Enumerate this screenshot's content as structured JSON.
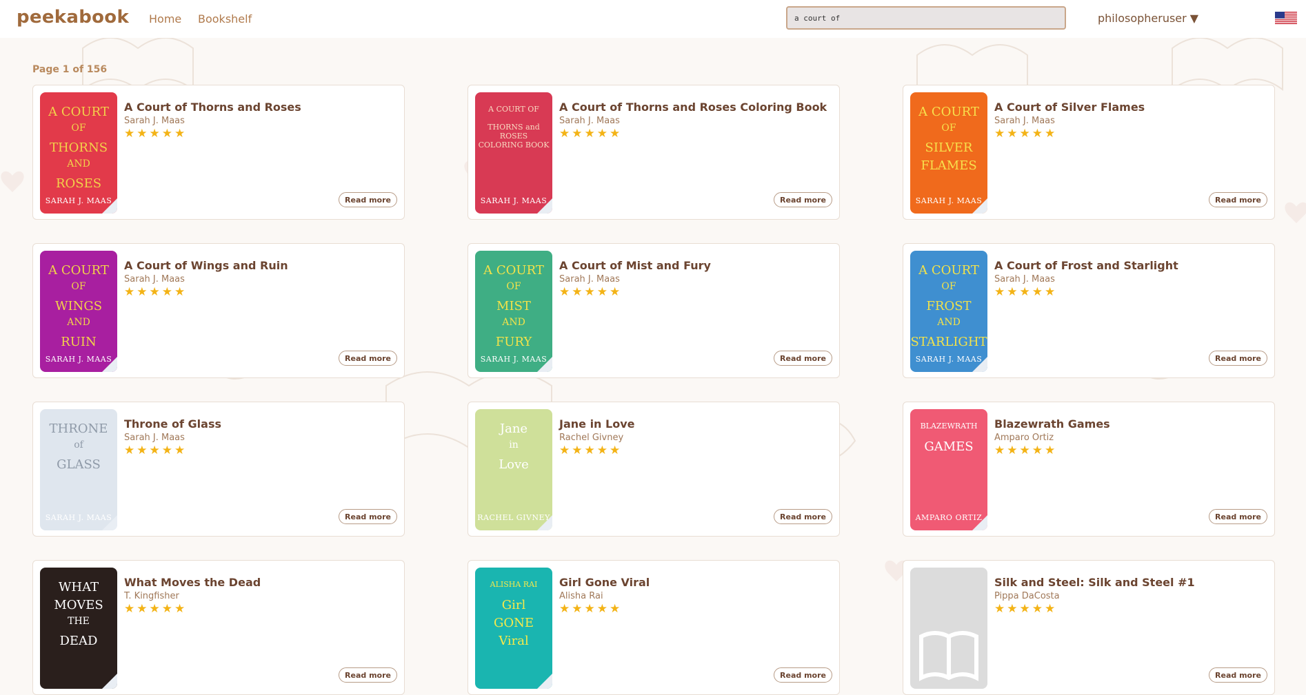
{
  "app": {
    "logo": "peekabook"
  },
  "nav": {
    "home": "Home",
    "bookshelf": "Bookshelf"
  },
  "search": {
    "value": "a court of"
  },
  "user": {
    "name": "philosopheruser ▼"
  },
  "page_info": "Page 1 of 156",
  "read_more_label": "Read more",
  "stars": "★★★★★",
  "rating_stars": 5,
  "books": [
    {
      "title": "A Court of Thorns and Roses",
      "author": "Sarah J. Maas",
      "cover": {
        "bg": "#e23a4a",
        "fg": "#f2d24a",
        "lines": [
          "A COURT",
          "OF",
          "THORNS",
          "AND",
          "ROSES"
        ],
        "band": "SARAH J. MAAS"
      }
    },
    {
      "title": "A Court of Thorns and Roses Coloring Book",
      "author": "Sarah J. Maas",
      "cover": {
        "bg": "#d83a54",
        "fg": "#f8d9c0",
        "lines": [
          "A COURT OF",
          "THORNS and ROSES",
          "COLORING BOOK"
        ],
        "band": "SARAH J. MAAS"
      }
    },
    {
      "title": "A Court of Silver Flames",
      "author": "Sarah J. Maas",
      "cover": {
        "bg": "#f06a1c",
        "fg": "#f7e04c",
        "lines": [
          "A COURT",
          "OF",
          "SILVER",
          "FLAMES"
        ],
        "band": "SARAH J. MAAS"
      }
    },
    {
      "title": "A Court of Wings and Ruin",
      "author": "Sarah J. Maas",
      "cover": {
        "bg": "#a81fa0",
        "fg": "#f2d24a",
        "lines": [
          "A COURT",
          "OF",
          "WINGS",
          "AND",
          "RUIN"
        ],
        "band": "SARAH J. MAAS"
      }
    },
    {
      "title": "A Court of Mist and Fury",
      "author": "Sarah J. Maas",
      "cover": {
        "bg": "#3fae84",
        "fg": "#f2e24a",
        "lines": [
          "A COURT",
          "OF",
          "MIST",
          "AND",
          "FURY"
        ],
        "band": "SARAH J. MAAS"
      }
    },
    {
      "title": "A Court of Frost and Starlight",
      "author": "Sarah J. Maas",
      "cover": {
        "bg": "#3f8fd0",
        "fg": "#f2e24a",
        "lines": [
          "A COURT",
          "OF",
          "FROST",
          "AND",
          "STARLIGHT"
        ],
        "band": "SARAH J. MAAS"
      }
    },
    {
      "title": "Throne of Glass",
      "author": "Sarah J. Maas",
      "cover": {
        "bg": "#dfe6ee",
        "fg": "#8f9aa8",
        "lines": [
          "THRONE",
          "of",
          "GLASS"
        ],
        "band": "SARAH J. MAAS"
      }
    },
    {
      "title": "Jane in Love",
      "author": "Rachel Givney",
      "cover": {
        "bg": "#cfe09a",
        "fg": "#ffffff",
        "lines": [
          "Jane",
          "in",
          "Love"
        ],
        "band": "RACHEL GIVNEY"
      }
    },
    {
      "title": "Blazewrath Games",
      "author": "Amparo Ortiz",
      "cover": {
        "bg": "#f05a74",
        "fg": "#ffffff",
        "lines": [
          "BLAZEWRATH",
          "GAMES"
        ],
        "band": "AMPARO ORTIZ"
      }
    },
    {
      "title": "What Moves the Dead",
      "author": "T. Kingfisher",
      "cover": {
        "bg": "#2a1f1c",
        "fg": "#ffffff",
        "lines": [
          "WHAT",
          "MOVES",
          "THE",
          "DEAD"
        ],
        "band": ""
      }
    },
    {
      "title": "Girl Gone Viral",
      "author": "Alisha Rai",
      "cover": {
        "bg": "#1ab5b0",
        "fg": "#f6e94a",
        "lines": [
          "ALISHA RAI",
          "Girl",
          "GONE",
          "Viral"
        ],
        "band": ""
      }
    },
    {
      "title": "Silk and Steel: Silk and Steel #1",
      "author": "Pippa DaCosta",
      "cover": {
        "bg": "#dcdcdc",
        "fg": "#ffffff",
        "lines": [],
        "band": "",
        "placeholder": true
      }
    }
  ]
}
